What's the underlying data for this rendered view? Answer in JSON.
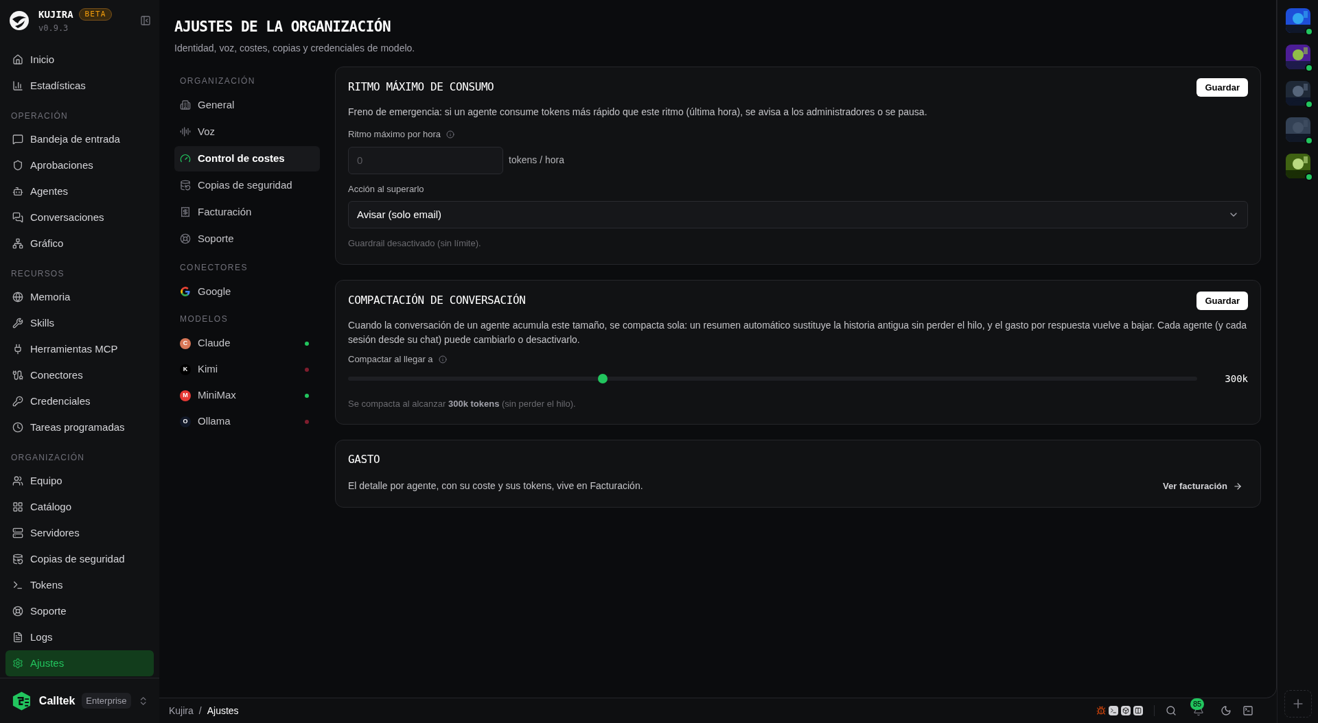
{
  "brand": {
    "name": "KUJIRA",
    "badge": "BETA",
    "version": "v0.9.3"
  },
  "sidebar": {
    "top_items": [
      {
        "label": "Inicio",
        "selected": false
      },
      {
        "label": "Estadísticas",
        "selected": false
      }
    ],
    "sections": [
      {
        "title": "OPERACIÓN",
        "items": [
          {
            "label": "Bandeja de entrada",
            "selected": false
          },
          {
            "label": "Aprobaciones",
            "selected": false
          },
          {
            "label": "Agentes",
            "selected": false
          },
          {
            "label": "Conversaciones",
            "selected": false
          },
          {
            "label": "Gráfico",
            "selected": false
          }
        ]
      },
      {
        "title": "RECURSOS",
        "items": [
          {
            "label": "Memoria",
            "selected": false
          },
          {
            "label": "Skills",
            "selected": false
          },
          {
            "label": "Herramientas MCP",
            "selected": false
          },
          {
            "label": "Conectores",
            "selected": false
          },
          {
            "label": "Credenciales",
            "selected": false
          },
          {
            "label": "Tareas programadas",
            "selected": false
          }
        ]
      },
      {
        "title": "ORGANIZACIÓN",
        "items": [
          {
            "label": "Equipo",
            "selected": false
          },
          {
            "label": "Catálogo",
            "selected": false
          },
          {
            "label": "Servidores",
            "selected": false
          },
          {
            "label": "Copias de seguridad",
            "selected": false
          },
          {
            "label": "Tokens",
            "selected": false
          },
          {
            "label": "Soporte",
            "selected": false
          },
          {
            "label": "Logs",
            "selected": false
          },
          {
            "label": "Ajustes",
            "selected": true
          }
        ]
      }
    ],
    "org": {
      "name": "Calltek",
      "plan": "Enterprise"
    }
  },
  "page": {
    "title": "AJUSTES DE LA ORGANIZACIÓN",
    "subtitle": "Identidad, voz, costes, copias y credenciales de modelo."
  },
  "settings_nav": {
    "organization": {
      "title": "ORGANIZACIÓN",
      "items": [
        {
          "label": "General",
          "selected": false
        },
        {
          "label": "Voz",
          "selected": false
        },
        {
          "label": "Control de costes",
          "selected": true
        },
        {
          "label": "Copias de seguridad",
          "selected": false
        },
        {
          "label": "Facturación",
          "selected": false
        },
        {
          "label": "Soporte",
          "selected": false
        }
      ]
    },
    "connectors": {
      "title": "CONECTORES",
      "items": [
        {
          "label": "Google"
        }
      ]
    },
    "models": {
      "title": "MODELOS",
      "items": [
        {
          "label": "Claude",
          "initial": "C",
          "color": "#22c55e"
        },
        {
          "label": "Kimi",
          "initial": "K",
          "color": "#7f1d2d"
        },
        {
          "label": "MiniMax",
          "initial": "M",
          "color": "#22c55e"
        },
        {
          "label": "Ollama",
          "initial": "O",
          "color": "#7f1d2d"
        }
      ]
    }
  },
  "rate_card": {
    "title": "RITMO MÁXIMO DE CONSUMO",
    "save": "Guardar",
    "description": "Freno de emergencia: si un agente consume tokens más rápido que este ritmo (última hora), se avisa a los administradores o se pausa.",
    "rate_label": "Ritmo máximo por hora",
    "rate_placeholder": "0",
    "rate_unit": "tokens / hora",
    "action_label": "Acción al superarlo",
    "action_value": "Avisar (solo email)",
    "hint": "Guardrail desactivado (sin límite)."
  },
  "compaction_card": {
    "title": "COMPACTACIÓN DE CONVERSACIÓN",
    "save": "Guardar",
    "description": "Cuando la conversación de un agente acumula este tamaño, se compacta sola: un resumen automático sustituye la historia antigua sin perder el hilo, y el gasto por respuesta vuelve a bajar. Cada agente (y cada sesión desde su chat) puede cambiarlo o desactivarlo.",
    "slider_label": "Compactar al llegar a",
    "level": 0.3,
    "reading": "300k",
    "hint": "Se compacta al alcanzar **300k tokens** (sin perder el hilo)."
  },
  "spend_card": {
    "title": "GASTO",
    "description": "El detalle por agente, con su coste y sus tokens, vive en Facturación.",
    "link": "Ver facturación"
  },
  "breadcrumb": [
    "Kujira",
    "/",
    "Ajustes"
  ],
  "status_bar": {
    "notifications": "85"
  },
  "avatars": [
    {
      "online": true
    },
    {
      "online": true
    },
    {
      "online": true
    },
    {
      "online": true
    },
    {
      "online": true
    }
  ]
}
